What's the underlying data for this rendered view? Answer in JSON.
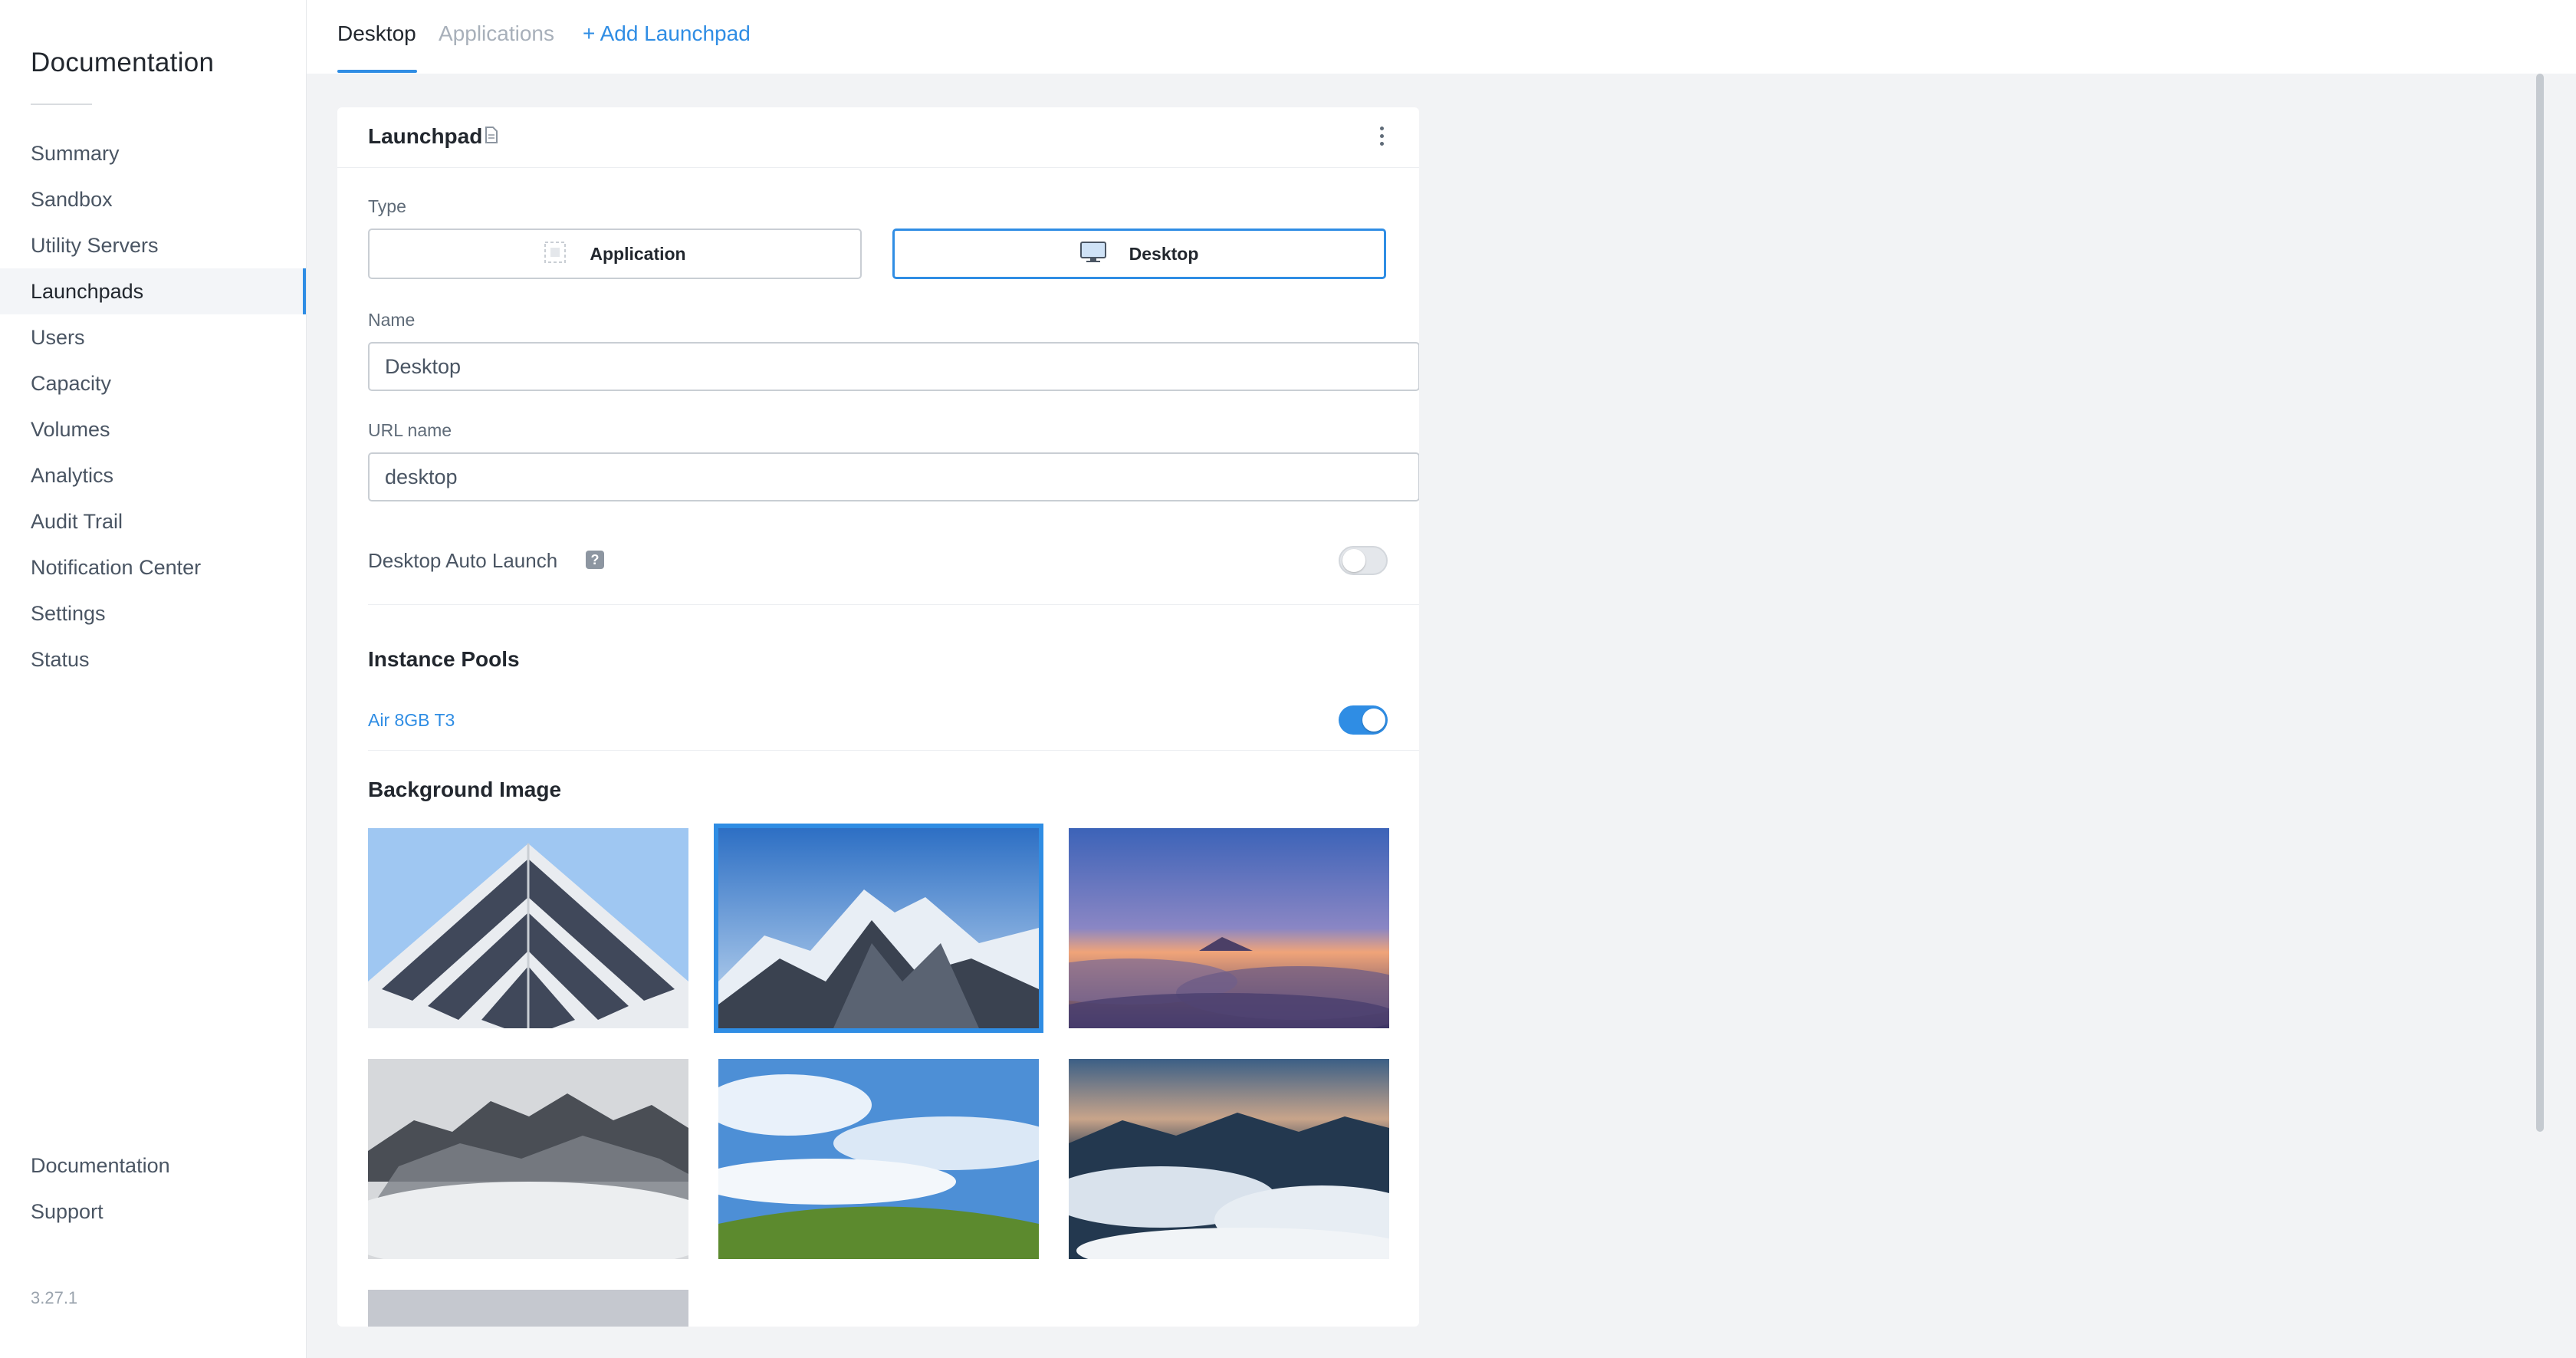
{
  "sidebar": {
    "brand": "Documentation",
    "items": [
      {
        "label": "Summary"
      },
      {
        "label": "Sandbox"
      },
      {
        "label": "Utility Servers"
      },
      {
        "label": "Launchpads"
      },
      {
        "label": "Users"
      },
      {
        "label": "Capacity"
      },
      {
        "label": "Volumes"
      },
      {
        "label": "Analytics"
      },
      {
        "label": "Audit Trail"
      },
      {
        "label": "Notification Center"
      },
      {
        "label": "Settings"
      },
      {
        "label": "Status"
      }
    ],
    "active_item": "Launchpads",
    "bottom_items": [
      {
        "label": "Documentation"
      },
      {
        "label": "Support"
      }
    ],
    "version": "3.27.1"
  },
  "tabs": {
    "desktop": "Desktop",
    "applications": "Applications",
    "add_launchpad": "+ Add Launchpad",
    "active": "Desktop"
  },
  "card": {
    "title": "Launchpad",
    "icons": {
      "title_icon": "document-icon",
      "menu_icon": "kebab-menu-icon"
    },
    "type": {
      "label": "Type",
      "options": [
        {
          "label": "Application",
          "icon": "application-icon"
        },
        {
          "label": "Desktop",
          "icon": "monitor-icon"
        }
      ],
      "selected": "Desktop"
    },
    "name": {
      "label": "Name",
      "value": "Desktop"
    },
    "url_name": {
      "label": "URL name",
      "value": "desktop"
    },
    "auto_launch": {
      "label": "Desktop Auto Launch",
      "help_glyph": "?",
      "enabled": false
    },
    "instance_pools": {
      "title": "Instance Pools",
      "pools": [
        {
          "name": "Air 8GB T3",
          "enabled": true
        }
      ]
    },
    "background": {
      "title": "Background Image",
      "selected_index": 1,
      "images": [
        {
          "subject": "white-geometric-building"
        },
        {
          "subject": "snowy-mountain-peaks"
        },
        {
          "subject": "sunset-above-clouds"
        },
        {
          "subject": "misty-mountain-ridge"
        },
        {
          "subject": "green-hill-blue-sky"
        },
        {
          "subject": "mountains-over-cloud-sea"
        },
        {
          "subject": "grey-placeholder"
        }
      ]
    }
  },
  "colors": {
    "accent": "#2f8de4",
    "page_background": "#f2f3f5",
    "text_primary": "#22272e",
    "text_muted": "#5f6b78"
  }
}
